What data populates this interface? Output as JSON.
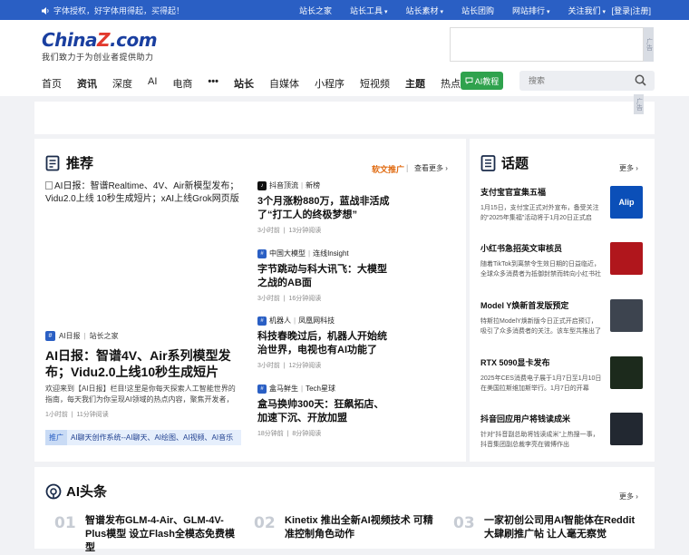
{
  "topbar": {
    "notice": "字体授权，好字体用得起，买得起！",
    "nav": [
      "站长之家",
      "站长工具",
      "站长素材",
      "站长团购",
      "网站排行",
      "关注我们"
    ],
    "dropdown_flags": [
      false,
      true,
      true,
      false,
      true,
      true
    ],
    "login": "[登录|注册]"
  },
  "logo": {
    "wordmark_a": "China",
    "wordmark_b": "Z",
    "wordmark_c": ".com",
    "slogan": "我们致力于为创业者提供助力"
  },
  "ad_label": "广告",
  "nav": {
    "items": [
      {
        "label": "首页",
        "bold": false
      },
      {
        "label": "资讯",
        "bold": true
      },
      {
        "label": "深度",
        "bold": false
      },
      {
        "label": "AI",
        "bold": false
      },
      {
        "label": "电商",
        "bold": false
      },
      {
        "label": "•••",
        "bold": true
      },
      {
        "label": "站长",
        "bold": true
      },
      {
        "label": "自媒体",
        "bold": false
      },
      {
        "label": "小程序",
        "bold": false
      },
      {
        "label": "短视频",
        "bold": false
      },
      {
        "label": "主题",
        "bold": true
      },
      {
        "label": "热点",
        "bold": false
      }
    ],
    "ai_button": "AI教程",
    "search_placeholder": "搜索"
  },
  "recommend": {
    "title": "推荐",
    "soft_ad": "软文推广",
    "more": "查看更多",
    "hero": {
      "image_alt": "AI日报：智谱Realtime、4V、Air新模型发布；Vidu2.0上线 10秒生成短片；xAI上线Grok网页版",
      "source": "AI日报",
      "source2": "站长之家",
      "title": "AI日报：智谱4V、Air系列模型发布；Vidu2.0上线10秒生成短片",
      "desc": "欢迎来到【AI日报】栏目!这里是你每天探索人工智能世界的指南，每天我们为你呈现AI领域的热点内容，聚焦开发者，",
      "time": "1小时前",
      "read": "11分钟阅读"
    },
    "promo_tag": "推广",
    "promo_text": "AI聊天创作系统--AI聊天、AI绘图、AI视频、AI音乐",
    "articles": [
      {
        "icon": "douyin-icon",
        "source": "抖音顶流",
        "source2": "新榜",
        "title": "3个月涨粉880万，蓝战非活成了“打工人的终极梦想”",
        "time": "3小时前",
        "read": "13分钟阅读"
      },
      {
        "icon": "publisher-icon",
        "source": "中国大模型",
        "source2": "连线Insight",
        "title": "字节跳动与科大讯飞：大模型之战的AB面",
        "time": "3小时前",
        "read": "16分钟阅读"
      },
      {
        "icon": "publisher-icon",
        "source": "机器人",
        "source2": "凤凰网科技",
        "title": "科技春晚过后，机器人开始统治世界，电视也有AI功能了",
        "time": "3小时前",
        "read": "12分钟阅读"
      },
      {
        "icon": "publisher-icon",
        "source": "盒马鲜生",
        "source2": "Tech星球",
        "title": "盒马换帅300天：狂飙拓店、加速下沉、开放加盟",
        "time": "18分钟前",
        "read": "8分钟阅读"
      }
    ]
  },
  "topics": {
    "title": "话题",
    "more": "更多",
    "items": [
      {
        "title": "支付宝官宣集五福",
        "desc": "1月15日，支付宝正式对外宣布，备受关注的“2025年集福”活动将于1月20日正式启",
        "thumb_color": "#0b4fb8",
        "thumb_text": "Alip"
      },
      {
        "title": "小红书急招英文审核员",
        "desc": "随着TikTok到离禁令生效日期的日益临近，全球众多消费者为抵御封禁而转向小红书社交",
        "thumb_color": "#b0161c",
        "thumb_text": ""
      },
      {
        "title": "Model Y焕新首发版预定",
        "desc": "特斯拉ModelY焕新版今日正式开启预订，吸引了众多消费者的关注。该车型共推出了",
        "thumb_color": "#3d444f",
        "thumb_text": ""
      },
      {
        "title": "RTX 5090显卡发布",
        "desc": "2025年CES消费电子展于1月7日至1月10日在美国拉斯维加斯举行。1月7日的开幕",
        "thumb_color": "#1c2a1c",
        "thumb_text": ""
      },
      {
        "title": "抖音回应用户将钱读成米",
        "desc": "针对“抖音副总助将钱读成米”上热搜一事，抖音集团副总裁李亮在微博作出",
        "thumb_color": "#222831",
        "thumb_text": ""
      }
    ]
  },
  "toutiao": {
    "title": "AI头条",
    "more": "更多",
    "items": [
      {
        "num": "01",
        "title": "智谱发布GLM-4-Air、GLM-4V-Plus模型 设立Flash全模态免费模型"
      },
      {
        "num": "02",
        "title": "Kinetix 推出全新AI视频技术 可精准控制角色动作"
      },
      {
        "num": "03",
        "title": "一家初创公司用AI智能体在Reddit大肆刷推广帖 让人毫无察觉"
      }
    ]
  },
  "colors": {
    "topbar": "#2a5fc4",
    "accent": "#2a5fc4",
    "ai_button": "#2fa24d",
    "soft_ad": "#e06a10"
  }
}
